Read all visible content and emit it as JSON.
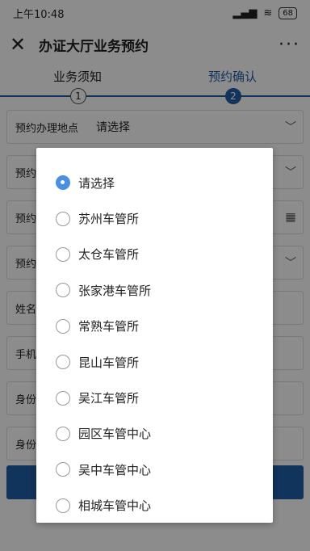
{
  "status": {
    "time": "上午10:48",
    "signal": "▂▄▆",
    "wifi": "≋",
    "battery": "68"
  },
  "header": {
    "close": "✕",
    "title": "办证大厅业务预约",
    "more": "···"
  },
  "steps": {
    "items": [
      {
        "label": "业务须知",
        "number": "1"
      },
      {
        "label": "预约确认",
        "number": "2"
      }
    ]
  },
  "form": {
    "rows": [
      {
        "label": "预约办理地点",
        "value": "请选择"
      },
      {
        "label": "预约",
        "value": ""
      },
      {
        "label": "预约",
        "value": ""
      },
      {
        "label": "预约",
        "value": ""
      },
      {
        "label": "姓名",
        "value": ""
      },
      {
        "label": "手机",
        "value": ""
      },
      {
        "label": "身份",
        "value": ""
      },
      {
        "label": "身份",
        "value": ""
      }
    ]
  },
  "dialog": {
    "options": [
      {
        "label": "请选择",
        "selected": true
      },
      {
        "label": "苏州车管所",
        "selected": false
      },
      {
        "label": "太仓车管所",
        "selected": false
      },
      {
        "label": "张家港车管所",
        "selected": false
      },
      {
        "label": "常熟车管所",
        "selected": false
      },
      {
        "label": "昆山车管所",
        "selected": false
      },
      {
        "label": "吴江车管所",
        "selected": false
      },
      {
        "label": "园区车管中心",
        "selected": false
      },
      {
        "label": "吴中车管中心",
        "selected": false
      },
      {
        "label": "相城车管中心",
        "selected": false
      }
    ]
  },
  "colors": {
    "accent": "#1f5fa8",
    "radio_selected": "#4a90e2"
  }
}
